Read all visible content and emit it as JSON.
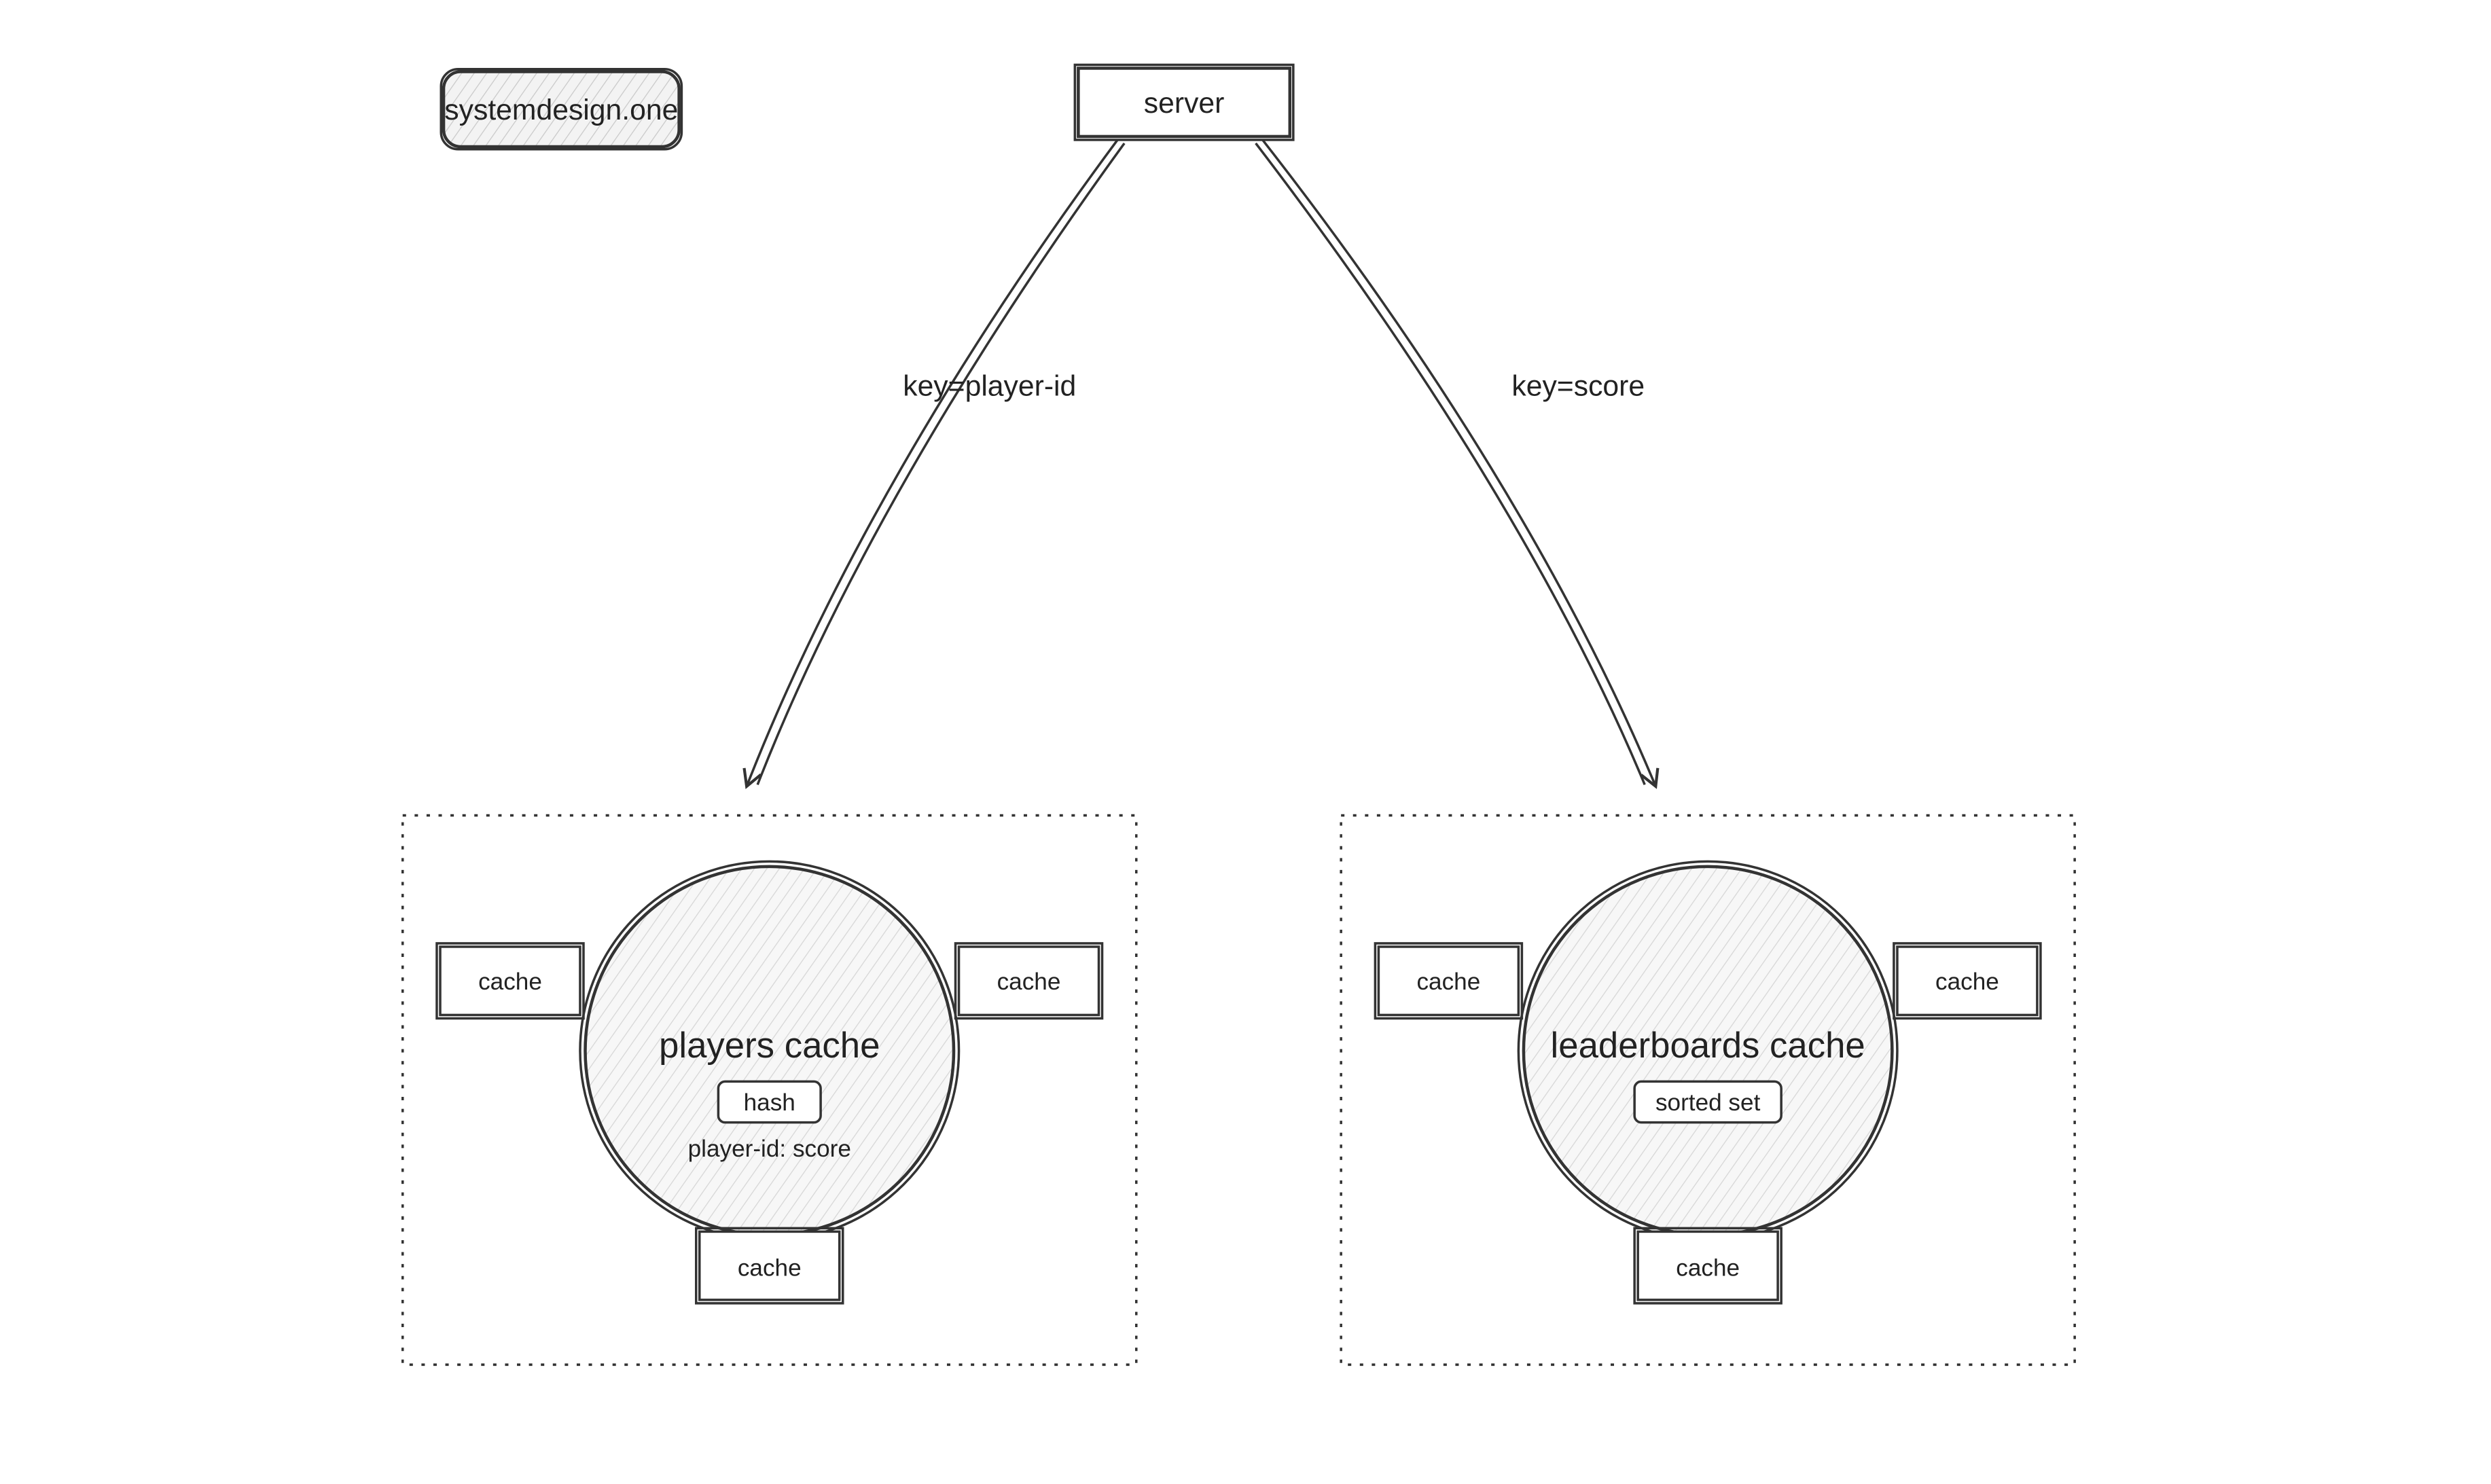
{
  "watermark": {
    "label": "systemdesign.one"
  },
  "server": {
    "label": "server"
  },
  "arrows": {
    "left": {
      "label": "key=player-id"
    },
    "right": {
      "label": "key=score"
    }
  },
  "clusters": {
    "players": {
      "title": "players cache",
      "type_tag": "hash",
      "subtitle": "player-id: score",
      "node_label": "cache"
    },
    "leaderboards": {
      "title": "leaderboards cache",
      "type_tag": "sorted set",
      "node_label": "cache"
    }
  }
}
